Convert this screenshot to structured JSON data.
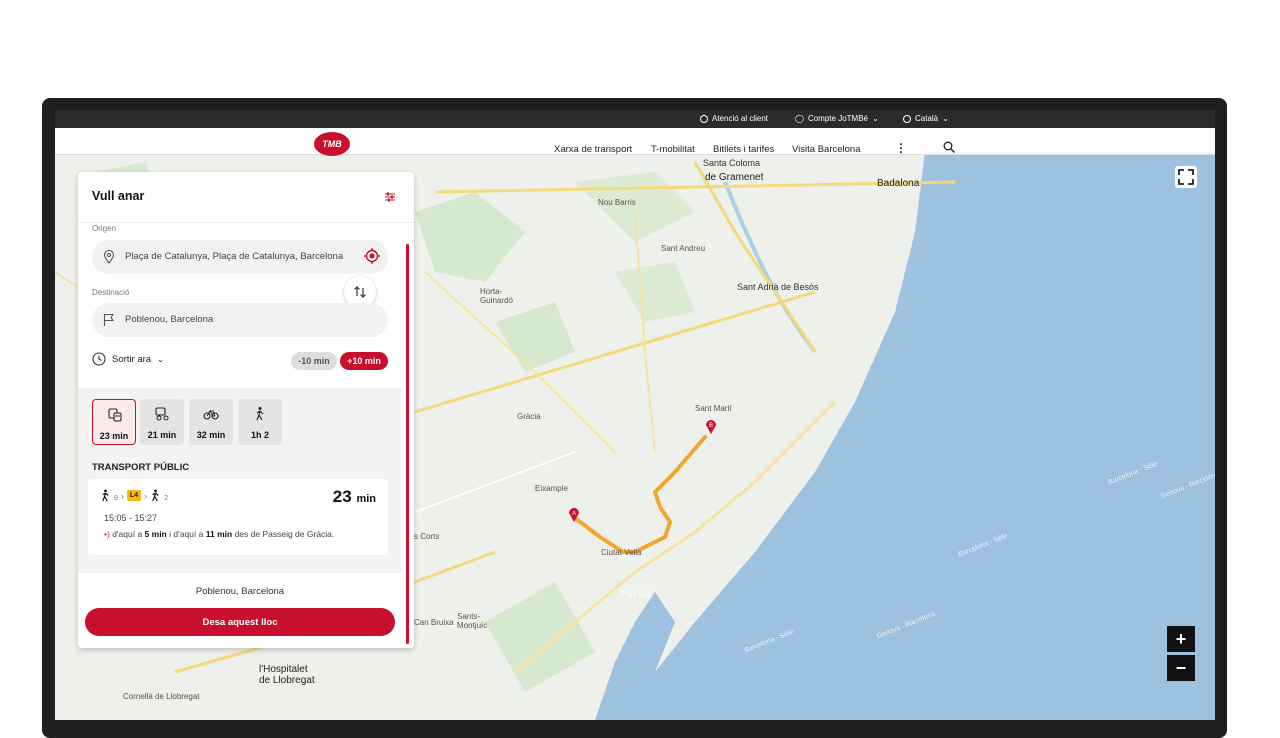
{
  "utility_bar": {
    "support": "Atenció al client",
    "account": "Compte JoTMBé",
    "language": "Català"
  },
  "header": {
    "logo": "TMB",
    "nav": [
      "Xarxa de transport",
      "T-mobilitat",
      "Bitllets i tarifes",
      "Visita Barcelona"
    ]
  },
  "map": {
    "labels": {
      "santa_coloma": "Santa Coloma",
      "de_gramenet": "de Gramenet",
      "badalona": "Badalona",
      "nou_barris": "Nou Barris",
      "sant_andreu": "Sant Andreu",
      "sant_adria": "Sant Adrià de Besòs",
      "horta": "Horta-\nGuinardó",
      "gracia": "Gràcia",
      "sant_marti": "Sant Martí",
      "eixample": "Eixample",
      "ciutat_vella": "Ciutat Vella",
      "port_vell": "Port Vell",
      "sants": "Sants-\nMontjuïc",
      "hospitalet": "l'Hospitalet\nde Llobregat",
      "cornella": "Cornellà de Llobregat",
      "les_corts": "s Corts",
      "can_bruixa": "Can Bruixa"
    },
    "sea_labels": [
      "Barcelona - Sète",
      "Genova - Barcelona",
      "Barcelona - Sète",
      "Barcelona - Sète",
      "Genova - Barcelona"
    ],
    "pins": {
      "origin": "A",
      "destination": "B"
    },
    "colors": {
      "sea": "#9ec1e0",
      "route": "#f2a62c",
      "accent": "#c8102e"
    }
  },
  "panel": {
    "title": "Vull anar",
    "origin_label": "Origen",
    "origin_value": "Plaça de Catalunya, Plaça de Catalunya, Barcelona",
    "destination_label": "Destinació",
    "destination_value": "Poblenou, Barcelona",
    "depart": "Sortir ara",
    "minus": "-10 min",
    "plus": "+10 min",
    "modes": [
      {
        "icon": "bus-metro-icon",
        "label": "23 min",
        "active": true
      },
      {
        "icon": "bus-bike-icon",
        "label": "21 min",
        "active": false
      },
      {
        "icon": "bike-icon",
        "label": "32 min",
        "active": false
      },
      {
        "icon": "walk-icon",
        "label": "1h 2",
        "active": false
      }
    ],
    "section_title": "TRANSPORT PÚBLIC",
    "route": {
      "walk1": "9",
      "line": "L4",
      "walk2": "2",
      "duration_num": "23",
      "duration_unit": "min",
      "times": "15:05 - 15:27",
      "next_pre": "d'aquí a",
      "next_1": "5 min",
      "next_mid": "i d'aquí a",
      "next_2": "11 min",
      "next_post": "des de Passeig de Gràcia."
    },
    "destination_name": "Poblenou, Barcelona",
    "save": "Desa aquest lloc"
  },
  "zoom": {
    "in": "+",
    "out": "−"
  }
}
